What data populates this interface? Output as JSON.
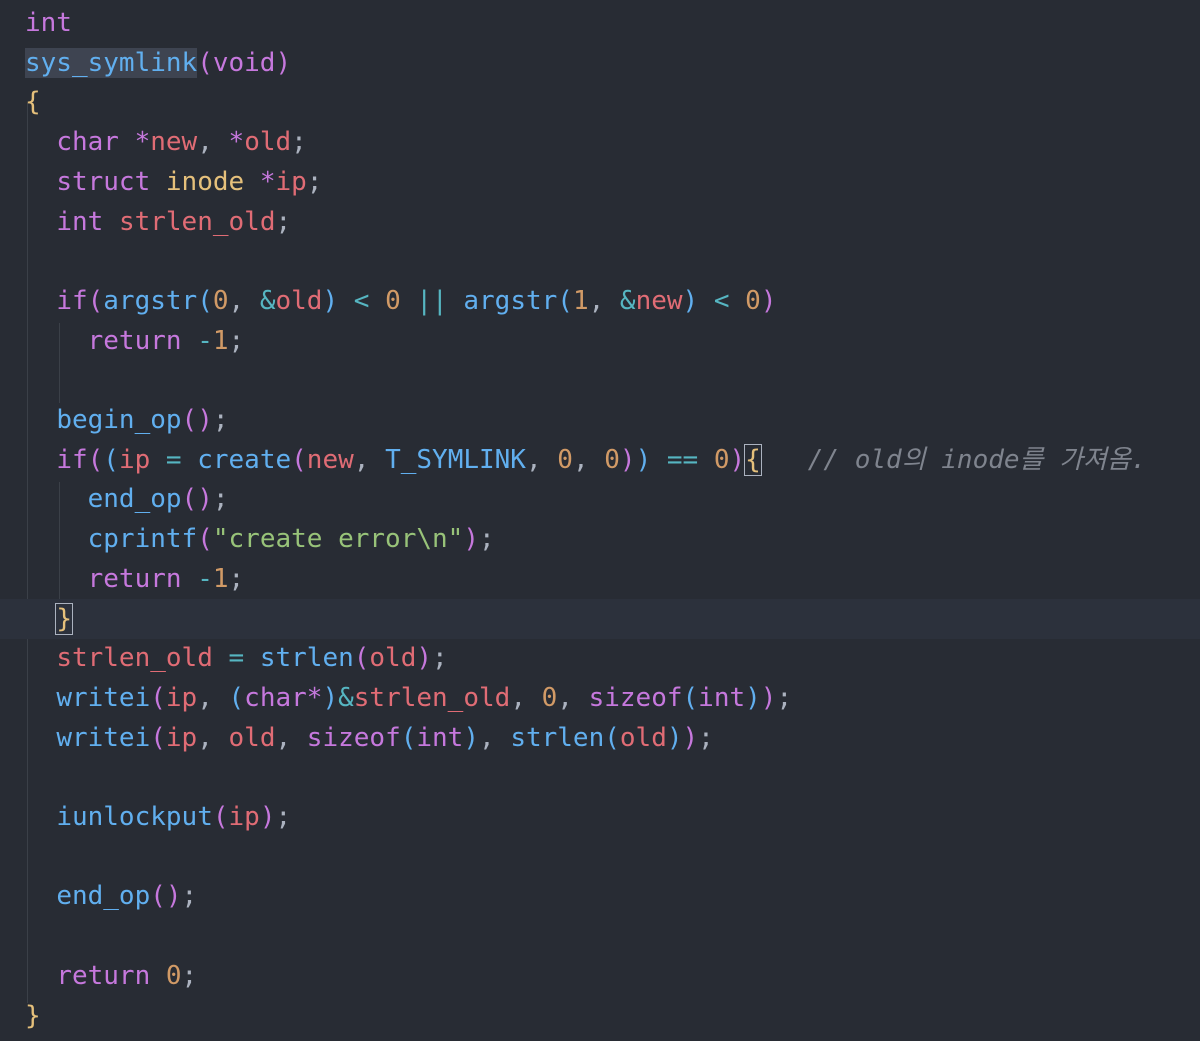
{
  "editor": {
    "language": "c",
    "lines": [
      [
        [
          "int",
          "kw"
        ]
      ],
      [
        [
          "sys_symlink",
          "fn-sel"
        ],
        [
          "(",
          "paren"
        ],
        [
          "void",
          "kw"
        ],
        [
          ")",
          "paren"
        ]
      ],
      [
        [
          "{",
          "brace"
        ]
      ],
      [
        [
          "  ",
          "ws"
        ],
        [
          "char",
          "kw"
        ],
        [
          " ",
          "ws"
        ],
        [
          "*",
          "kw"
        ],
        [
          "new",
          "var"
        ],
        [
          ", ",
          "punc"
        ],
        [
          "*",
          "kw"
        ],
        [
          "old",
          "var"
        ],
        [
          ";",
          "punc"
        ]
      ],
      [
        [
          "  ",
          "ws"
        ],
        [
          "struct",
          "kw"
        ],
        [
          " ",
          "ws"
        ],
        [
          "inode",
          "type"
        ],
        [
          " ",
          "ws"
        ],
        [
          "*",
          "kw"
        ],
        [
          "ip",
          "var"
        ],
        [
          ";",
          "punc"
        ]
      ],
      [
        [
          "  ",
          "ws"
        ],
        [
          "int",
          "kw"
        ],
        [
          " ",
          "ws"
        ],
        [
          "strlen_old",
          "var"
        ],
        [
          ";",
          "punc"
        ]
      ],
      [],
      [
        [
          "  ",
          "ws"
        ],
        [
          "if",
          "kw"
        ],
        [
          "(",
          "paren"
        ],
        [
          "argstr",
          "fn"
        ],
        [
          "(",
          "paren2"
        ],
        [
          "0",
          "num"
        ],
        [
          ", ",
          "punc"
        ],
        [
          "&",
          "op"
        ],
        [
          "old",
          "var"
        ],
        [
          ")",
          "paren2"
        ],
        [
          " < ",
          "op"
        ],
        [
          "0",
          "num"
        ],
        [
          " || ",
          "op"
        ],
        [
          "argstr",
          "fn"
        ],
        [
          "(",
          "paren2"
        ],
        [
          "1",
          "num"
        ],
        [
          ", ",
          "punc"
        ],
        [
          "&",
          "op"
        ],
        [
          "new",
          "var"
        ],
        [
          ")",
          "paren2"
        ],
        [
          " < ",
          "op"
        ],
        [
          "0",
          "num"
        ],
        [
          ")",
          "paren"
        ]
      ],
      [
        [
          "    ",
          "ws"
        ],
        [
          "return",
          "kw"
        ],
        [
          " ",
          "ws"
        ],
        [
          "-",
          "op"
        ],
        [
          "1",
          "num"
        ],
        [
          ";",
          "punc"
        ]
      ],
      [],
      [
        [
          "  ",
          "ws"
        ],
        [
          "begin_op",
          "fn"
        ],
        [
          "(",
          "paren"
        ],
        [
          ")",
          "paren"
        ],
        [
          ";",
          "punc"
        ]
      ],
      [
        [
          "  ",
          "ws"
        ],
        [
          "if",
          "kw"
        ],
        [
          "(",
          "paren"
        ],
        [
          "(",
          "paren2"
        ],
        [
          "ip",
          "var"
        ],
        [
          " = ",
          "op"
        ],
        [
          "create",
          "fn"
        ],
        [
          "(",
          "paren"
        ],
        [
          "new",
          "var"
        ],
        [
          ", ",
          "punc"
        ],
        [
          "T_SYMLINK",
          "fn"
        ],
        [
          ", ",
          "punc"
        ],
        [
          "0",
          "num"
        ],
        [
          ", ",
          "punc"
        ],
        [
          "0",
          "num"
        ],
        [
          ")",
          "paren"
        ],
        [
          ")",
          "paren2"
        ],
        [
          " == ",
          "op"
        ],
        [
          "0",
          "num"
        ],
        [
          ")",
          "paren"
        ],
        [
          "{",
          "brace-match"
        ],
        [
          "   ",
          "ws"
        ],
        [
          "// old의 inode를 가져옴.",
          "comment"
        ]
      ],
      [
        [
          "    ",
          "ws"
        ],
        [
          "end_op",
          "fn"
        ],
        [
          "(",
          "paren"
        ],
        [
          ")",
          "paren"
        ],
        [
          ";",
          "punc"
        ]
      ],
      [
        [
          "    ",
          "ws"
        ],
        [
          "cprintf",
          "fn"
        ],
        [
          "(",
          "paren"
        ],
        [
          "\"create error\\n\"",
          "str"
        ],
        [
          ")",
          "paren"
        ],
        [
          ";",
          "punc"
        ]
      ],
      [
        [
          "    ",
          "ws"
        ],
        [
          "return",
          "kw"
        ],
        [
          " ",
          "ws"
        ],
        [
          "-",
          "op"
        ],
        [
          "1",
          "num"
        ],
        [
          ";",
          "punc"
        ]
      ],
      [
        [
          "  ",
          "ws"
        ],
        [
          "}",
          "brace-match"
        ]
      ],
      [
        [
          "  ",
          "ws"
        ],
        [
          "strlen_old",
          "var"
        ],
        [
          " = ",
          "op"
        ],
        [
          "strlen",
          "fn"
        ],
        [
          "(",
          "paren"
        ],
        [
          "old",
          "var"
        ],
        [
          ")",
          "paren"
        ],
        [
          ";",
          "punc"
        ]
      ],
      [
        [
          "  ",
          "ws"
        ],
        [
          "writei",
          "fn"
        ],
        [
          "(",
          "paren"
        ],
        [
          "ip",
          "var"
        ],
        [
          ", ",
          "punc"
        ],
        [
          "(",
          "paren2"
        ],
        [
          "char",
          "kw"
        ],
        [
          "*",
          "kw"
        ],
        [
          ")",
          "paren2"
        ],
        [
          "&",
          "op"
        ],
        [
          "strlen_old",
          "var"
        ],
        [
          ", ",
          "punc"
        ],
        [
          "0",
          "num"
        ],
        [
          ", ",
          "punc"
        ],
        [
          "sizeof",
          "kw"
        ],
        [
          "(",
          "paren2"
        ],
        [
          "int",
          "kw"
        ],
        [
          ")",
          "paren2"
        ],
        [
          ")",
          "paren"
        ],
        [
          ";",
          "punc"
        ]
      ],
      [
        [
          "  ",
          "ws"
        ],
        [
          "writei",
          "fn"
        ],
        [
          "(",
          "paren"
        ],
        [
          "ip",
          "var"
        ],
        [
          ", ",
          "punc"
        ],
        [
          "old",
          "var"
        ],
        [
          ", ",
          "punc"
        ],
        [
          "sizeof",
          "kw"
        ],
        [
          "(",
          "paren2"
        ],
        [
          "int",
          "kw"
        ],
        [
          ")",
          "paren2"
        ],
        [
          ", ",
          "punc"
        ],
        [
          "strlen",
          "fn"
        ],
        [
          "(",
          "paren2"
        ],
        [
          "old",
          "var"
        ],
        [
          ")",
          "paren2"
        ],
        [
          ")",
          "paren"
        ],
        [
          ";",
          "punc"
        ]
      ],
      [],
      [
        [
          "  ",
          "ws"
        ],
        [
          "iunlockput",
          "fn"
        ],
        [
          "(",
          "paren"
        ],
        [
          "ip",
          "var"
        ],
        [
          ")",
          "paren"
        ],
        [
          ";",
          "punc"
        ]
      ],
      [],
      [
        [
          "  ",
          "ws"
        ],
        [
          "end_op",
          "fn"
        ],
        [
          "(",
          "paren"
        ],
        [
          ")",
          "paren"
        ],
        [
          ";",
          "punc"
        ]
      ],
      [],
      [
        [
          "  ",
          "ws"
        ],
        [
          "return",
          "kw"
        ],
        [
          " ",
          "ws"
        ],
        [
          "0",
          "num"
        ],
        [
          ";",
          "punc"
        ]
      ],
      [
        [
          "}",
          "brace"
        ]
      ]
    ],
    "current_line_index": 15,
    "colors": {
      "background": "#282c34",
      "keyword": "#c678dd",
      "function": "#61afef",
      "variable": "#e06c75",
      "number": "#d19a66",
      "string": "#98c379",
      "type": "#e5c07b",
      "comment": "#7f848e"
    }
  }
}
